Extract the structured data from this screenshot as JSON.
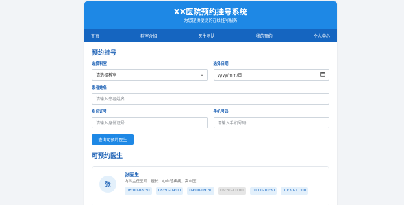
{
  "header": {
    "title": "XX医院预约挂号系统",
    "subtitle": "为您提供便捷的在线挂号服务"
  },
  "nav": {
    "items": [
      "首页",
      "科室介绍",
      "医生团队",
      "我的预约",
      "个人中心"
    ]
  },
  "form": {
    "title": "预约挂号",
    "department_label": "选择科室",
    "department_value": "请选择科室",
    "date_label": "选择日期",
    "date_value": "yyyy/mm/日",
    "name_label": "患者姓名",
    "name_placeholder": "请输入患者姓名",
    "id_label": "身份证号",
    "id_placeholder": "请输入身份证号",
    "phone_label": "手机号码",
    "phone_placeholder": "请输入手机号码",
    "query_button": "查询可预约医生"
  },
  "doctors": {
    "title": "可预约医生",
    "items": [
      {
        "avatar_char": "张",
        "name": "张医生",
        "desc": "内科主任医师 | 擅长：心血管疾病、高血压",
        "slots": [
          {
            "time": "08:00-08:30",
            "available": true
          },
          {
            "time": "08:30-09:00",
            "available": true
          },
          {
            "time": "09:00-09:30",
            "available": true
          },
          {
            "time": "09:30-10:00",
            "available": false
          },
          {
            "time": "10:00-10:30",
            "available": true
          },
          {
            "time": "10:30-11:00",
            "available": true
          }
        ]
      }
    ]
  },
  "colors": {
    "primary": "#1e88e5",
    "nav": "#1565c0",
    "accent_text": "#1a5fb4"
  }
}
